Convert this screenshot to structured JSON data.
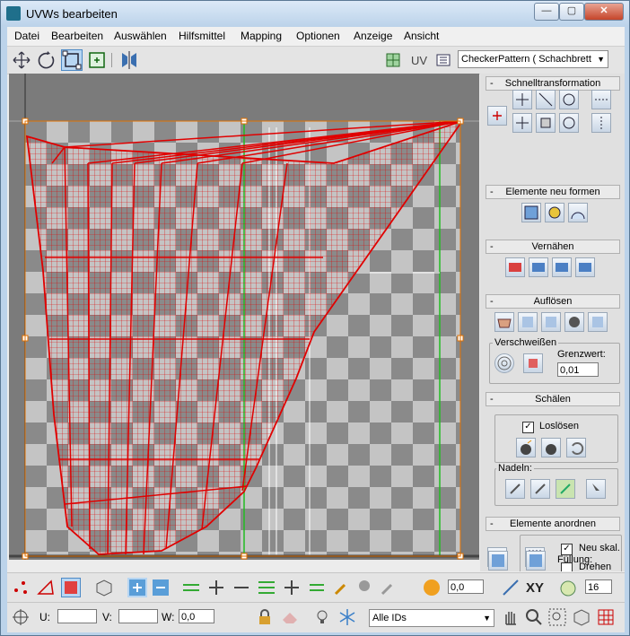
{
  "window": {
    "title": "UVWs bearbeiten",
    "min": "—",
    "max": "▢",
    "close": "✕"
  },
  "menu": [
    "Datei",
    "Bearbeiten",
    "Auswählen",
    "Hilfsmittel",
    "Mapping",
    "Optionen",
    "Anzeige",
    "Ansicht"
  ],
  "toolbar": {
    "uv_label": "UV",
    "texture_combo": "CheckerPattern  ( Schachbrett"
  },
  "panel": {
    "quick_transform": "Schnelltransformation",
    "reshape": "Elemente neu formen",
    "stitch": "Vernähen",
    "explode": "Auflösen",
    "weld": "Verschweißen",
    "threshold_label": "Grenzwert:",
    "threshold_value": "0,01",
    "peel": "Schälen",
    "detach_label": "Loslösen",
    "pins_label": "Nadeln:",
    "arrange": "Elemente anordnen",
    "rescale_label": "Neu skal.",
    "rotate_label": "Drehen",
    "padding_label": "Füllung:"
  },
  "bottom": {
    "soft_value": "0,0",
    "xy_label": "XY",
    "num_value": "16",
    "u_label": "U:",
    "v_label": "V:",
    "w_label": "W:",
    "w_value": "0,0",
    "ids_combo": "Alle IDs"
  },
  "colors": {
    "uv_wire": "#e00000",
    "viewport_bg": "#7b7b7b",
    "green_edge": "#22bb22"
  }
}
